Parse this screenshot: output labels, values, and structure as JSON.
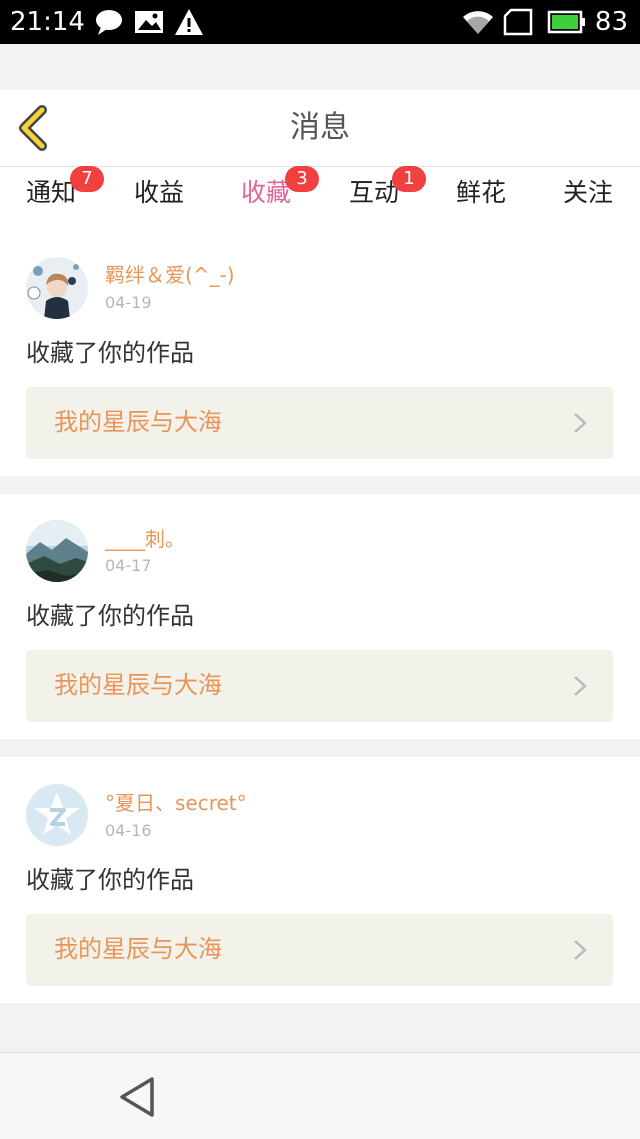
{
  "status_bar": {
    "time": "21:14",
    "battery": "83",
    "icons": [
      "chat-bubble-icon",
      "image-icon",
      "warning-icon",
      "wifi-icon",
      "sim-icon",
      "battery-icon"
    ]
  },
  "header": {
    "title": "消息",
    "back_icon": "chevron-left-icon",
    "accent_color": "#f2d43a"
  },
  "tabs": [
    {
      "label": "通知",
      "badge": "7",
      "active": false
    },
    {
      "label": "收益",
      "badge": null,
      "active": false
    },
    {
      "label": "收藏",
      "badge": "3",
      "active": true
    },
    {
      "label": "互动",
      "badge": "1",
      "active": false
    },
    {
      "label": "鲜花",
      "badge": null,
      "active": false
    },
    {
      "label": "关注",
      "badge": null,
      "active": false
    }
  ],
  "colors": {
    "active_tab": "#e0659c",
    "badge": "#f0403f",
    "username": "#e9955a",
    "work_bg": "#f3f2ea"
  },
  "messages": [
    {
      "username": "羁绊＆爱(^_-)",
      "date": "04-19",
      "action": "收藏了你的作品",
      "work_title": "我的星辰与大海",
      "avatar": "user-photo-avatar"
    },
    {
      "username": "____刺。",
      "date": "04-17",
      "action": "收藏了你的作品",
      "work_title": "我的星辰与大海",
      "avatar": "landscape-avatar"
    },
    {
      "username": "°夏日、secret°",
      "date": "04-16",
      "action": "收藏了你的作品",
      "work_title": "我的星辰与大海",
      "avatar": "default-star-avatar"
    }
  ],
  "nav_bar": {
    "back_icon": "triangle-back-icon"
  }
}
